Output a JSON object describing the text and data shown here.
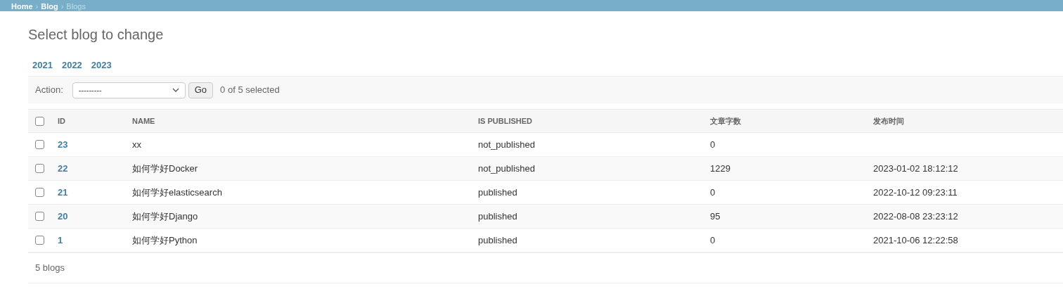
{
  "breadcrumbs": [
    "Home",
    "Blog",
    "Blogs"
  ],
  "breadcrumb_separator": "›",
  "title": "Select blog to change",
  "date_hierarchy": [
    "2021",
    "2022",
    "2023"
  ],
  "actions": {
    "label": "Action:",
    "select_value": "---------",
    "go": "Go",
    "counter": "0 of 5 selected"
  },
  "table": {
    "select_all_checked": false,
    "columns": [
      "ID",
      "NAME",
      "IS PUBLISHED",
      "文章字数",
      "发布时间"
    ],
    "rows": [
      {
        "checked": false,
        "cells": [
          "23",
          "xx",
          "not_published",
          "0",
          ""
        ]
      },
      {
        "checked": false,
        "cells": [
          "22",
          "如何学好Docker",
          "not_published",
          "1229",
          "2023-01-02 18:12:12"
        ]
      },
      {
        "checked": false,
        "cells": [
          "21",
          "如何学好elasticsearch",
          "published",
          "0",
          "2022-10-12 09:23:11"
        ]
      },
      {
        "checked": false,
        "cells": [
          "20",
          "如何学好Django",
          "published",
          "95",
          "2022-08-08 23:23:12"
        ]
      },
      {
        "checked": false,
        "cells": [
          "1",
          "如何学好Python",
          "published",
          "0",
          "2021-10-06 12:22:58"
        ]
      }
    ]
  },
  "paginator": "5 blogs"
}
